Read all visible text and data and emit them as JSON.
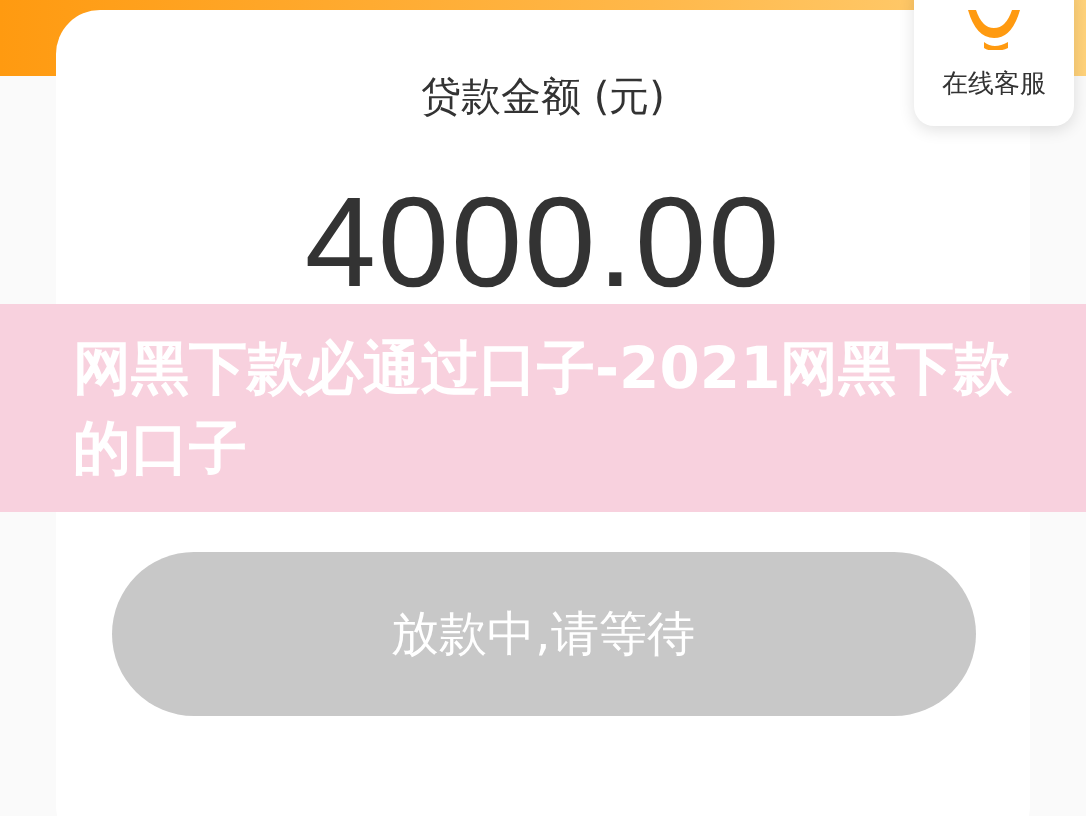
{
  "service": {
    "label": "在线客服"
  },
  "loan": {
    "label": "贷款金额 (元)",
    "amount": "4000.00"
  },
  "banner": {
    "title": "网黑下款必通过口子-2021网黑下款的口子"
  },
  "status_button": {
    "label": "放款中,请等待",
    "disabled": true
  }
}
